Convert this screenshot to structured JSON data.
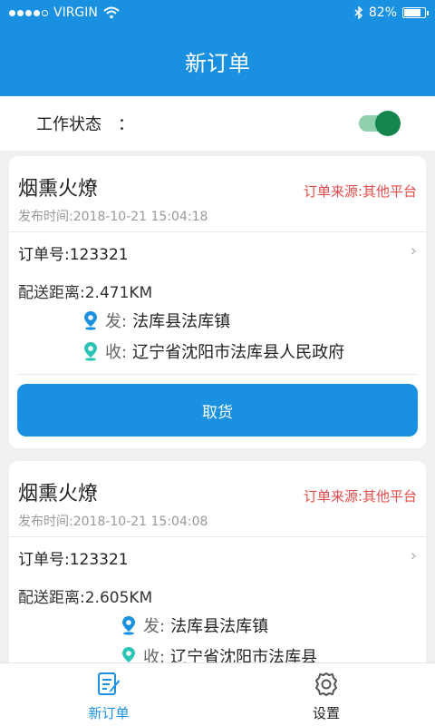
{
  "status_bar": {
    "carrier": "VIRGIN",
    "battery_text": "82%",
    "battery_level": 0.82
  },
  "header": {
    "title": "新订单"
  },
  "work_status": {
    "label": "工作状态　：",
    "toggle_on": true
  },
  "orders": [
    {
      "title": "烟熏火燎",
      "source": "订单来源:其他平台",
      "time": "发布时间:2018-10-21 15:04:18",
      "order_no": "订单号:123321",
      "distance": "配送距离:2.471KM",
      "from_label": "发:",
      "from": "法库县法库镇",
      "to_label": "收:",
      "to": "辽宁省沈阳市法库县人民政府",
      "action": "取货"
    },
    {
      "title": "烟熏火燎",
      "source": "订单来源:其他平台",
      "time": "发布时间:2018-10-21 15:04:08",
      "order_no": "订单号:123321",
      "distance": "配送距离:2.605KM",
      "from_label": "发:",
      "from": "法库县法库镇",
      "to_label": "收:",
      "to": "辽宁省沈阳市法库县"
    }
  ],
  "tabbar": {
    "tabs": [
      {
        "label": "新订单",
        "icon": "new-order-icon",
        "active": true
      },
      {
        "label": "设置",
        "icon": "settings-gear-icon",
        "active": false
      }
    ]
  },
  "colors": {
    "primary": "#1a91e0",
    "source_red": "#e04a4a",
    "toggle_green": "#14854f"
  }
}
